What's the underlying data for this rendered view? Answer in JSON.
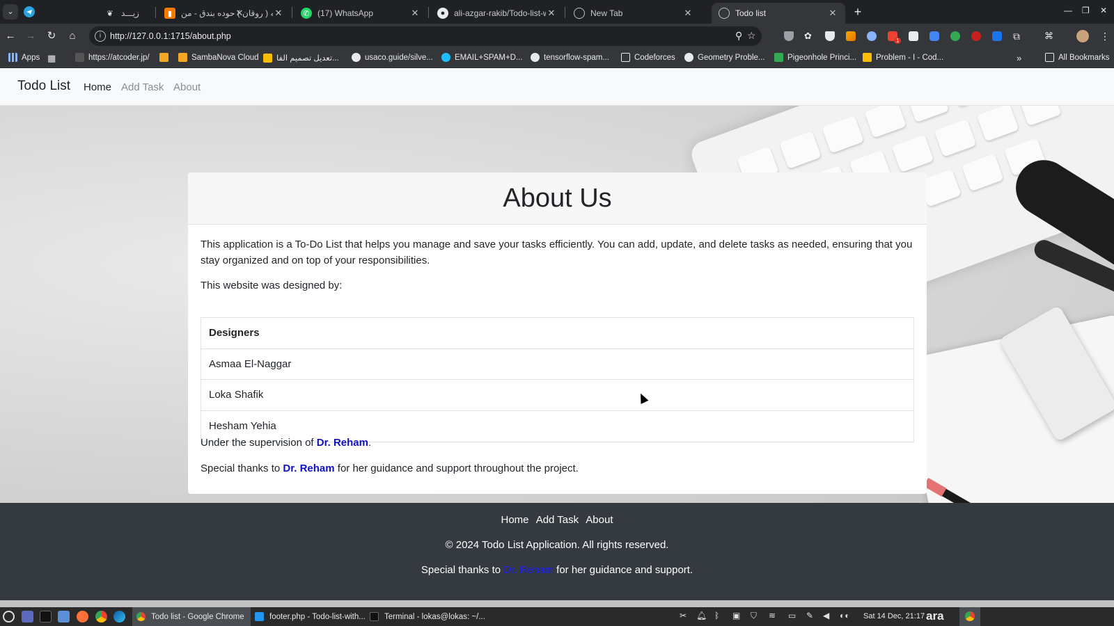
{
  "browser": {
    "tabs": [
      {
        "title": "زيـــد",
        "fav_color": "#e8eaed"
      },
      {
        "title": "اغنيه ( روقان ) حوده بندق - من",
        "fav_color": "#f57c00"
      },
      {
        "title": "(17) WhatsApp",
        "fav_color": "#25d366"
      },
      {
        "title": "ali-azgar-rakib/Todo-list-wit",
        "fav_color": "#e8eaed"
      },
      {
        "title": "New Tab",
        "fav_color": "#bdc1c6"
      },
      {
        "title": "Todo list",
        "fav_color": "#bdc1c6"
      }
    ],
    "url": "http://127.0.0.1:1715/about.php",
    "extension_badge": "1",
    "bookmarks": [
      {
        "label": "Apps",
        "color": "#8ab4f8"
      },
      {
        "label": "https://atcoder.jp/",
        "color": "#9e9e9e"
      },
      {
        "label": "SambaNova Cloud",
        "color": "#f5a623"
      },
      {
        "label": "تعديل تصميم الفا...",
        "color": "#fbbc04"
      },
      {
        "label": "usaco.guide/silve...",
        "color": "#e8eaed"
      },
      {
        "label": "EMAIL+SPAM+D...",
        "color": "#20beff"
      },
      {
        "label": "tensorflow-spam...",
        "color": "#e8eaed"
      },
      {
        "label": "Codeforces",
        "color": "#e8eaed"
      },
      {
        "label": "Geometry Proble...",
        "color": "#e8eaed"
      },
      {
        "label": "Pigeonhole Princi...",
        "color": "#34a853"
      },
      {
        "label": "Problem - I - Cod...",
        "color": "#fbbc04"
      }
    ],
    "all_bookmarks": "All Bookmarks"
  },
  "site": {
    "brand": "Todo List",
    "nav": [
      "Home",
      "Add Task",
      "About"
    ],
    "heading": "About Us",
    "intro": "This application is a To-Do List that helps you manage and save your tasks efficiently. You can add, update, and delete tasks as needed, ensuring that you stay organized and on top of your responsibilities.",
    "designed_by": "This website was designed by:",
    "table_header": "Designers",
    "designers": [
      "Asmaa El-Naggar",
      "Loka Shafik",
      "Hesham Yehia"
    ],
    "supervision_prefix": "Under the supervision of ",
    "supervisor": "Dr. Reham",
    "supervision_suffix": ".",
    "thanks_prefix": "Special thanks to ",
    "thanks_name": "Dr. Reham",
    "thanks_suffix": " for her guidance and support throughout the project.",
    "accent_color": "#1010c8"
  },
  "footer": {
    "links": [
      "Home",
      "Add Task",
      "About"
    ],
    "copyright": "© 2024 Todo List Application. All rights reserved.",
    "thanks_prefix": "Special thanks to ",
    "thanks_name": "Dr. Reham",
    "thanks_suffix": " for her guidance and support."
  },
  "taskbar": {
    "tasks": [
      "Todo list - Google Chrome",
      "footer.php - Todo-list-with...",
      "Terminal - lokas@lokas: ~/..."
    ],
    "clock": "Sat 14 Dec, 21:17",
    "language": "ara"
  }
}
